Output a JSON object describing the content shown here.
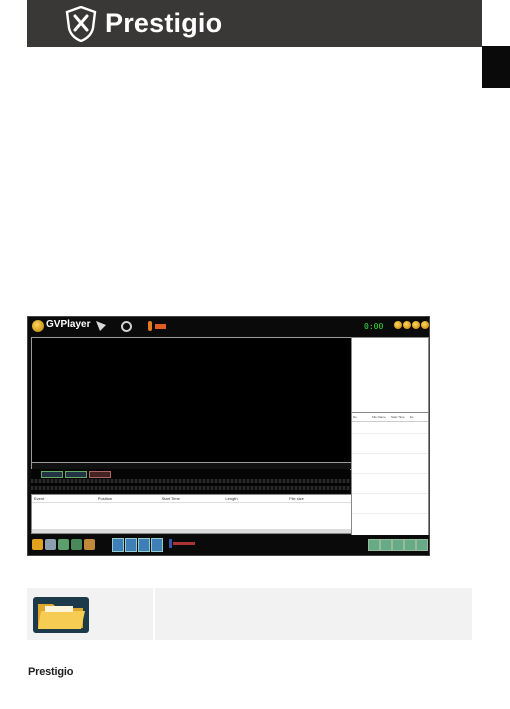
{
  "header": {
    "brand": "Prestigio"
  },
  "player": {
    "title": "GVPlayer",
    "lcd": "0:00",
    "channel_buttons": [
      "",
      "",
      ""
    ],
    "event_columns": [
      "Event",
      "Position",
      "Start Time",
      "Length",
      "File size"
    ],
    "list_columns": [
      "No",
      "File Name",
      "Start Time",
      "Ev"
    ]
  },
  "footer": {
    "brand": "Prestigio"
  },
  "icons": {
    "header_logo": "prestigio-shield-icon",
    "table_icon": "folder-icon"
  },
  "colors": {
    "header_bg": "#3a3737",
    "tab": "#0a0a0a",
    "lcd": "#35e03a",
    "table_bg": "#f2f2f2"
  }
}
